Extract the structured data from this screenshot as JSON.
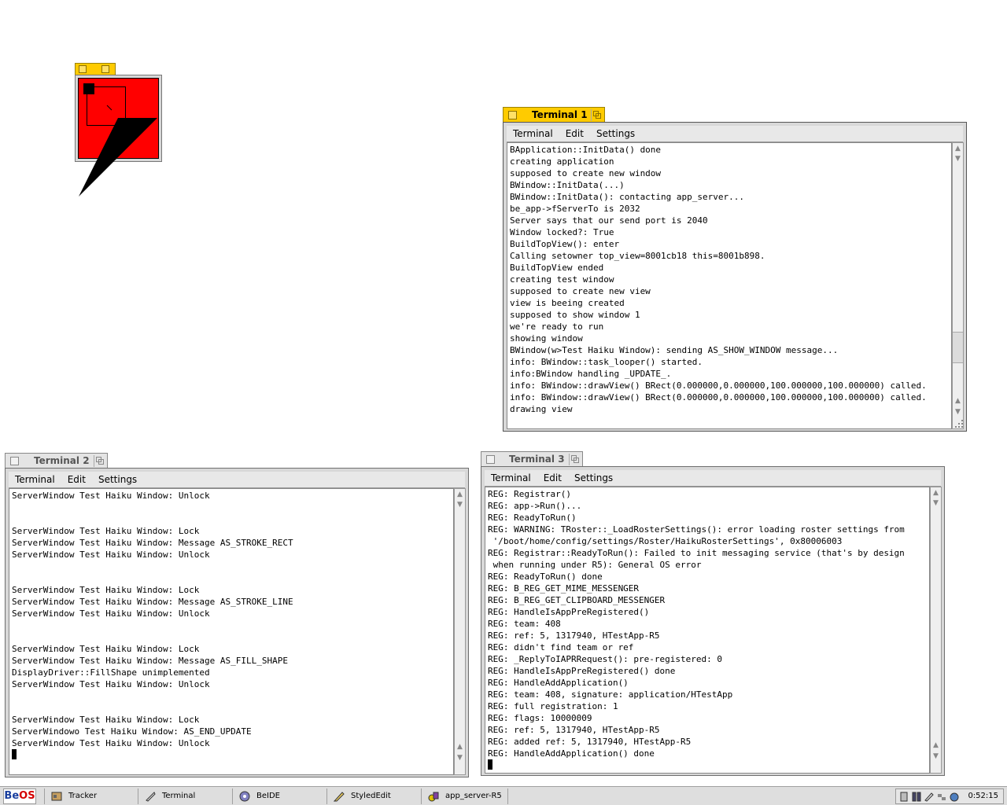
{
  "terminal1": {
    "title": "Terminal 1",
    "menu": [
      "Terminal",
      "Edit",
      "Settings"
    ],
    "lines": [
      "BApplication::InitData() done",
      "creating application",
      "supposed to create new window",
      "BWindow::InitData(...)",
      "BWindow::InitData(): contacting app_server...",
      "be_app->fServerTo is 2032",
      "Server says that our send port is 2040",
      "Window locked?: True",
      "BuildTopView(): enter",
      "Calling setowner top_view=8001cb18 this=8001b898.",
      "BuildTopView ended",
      "creating test window",
      "supposed to create new view",
      "view is beeing created",
      "supposed to show window 1",
      "we're ready to run",
      "showing window",
      "BWindow(w>Test Haiku Window): sending AS_SHOW_WINDOW message...",
      "info: BWindow::task_looper() started.",
      "info:BWindow handling _UPDATE_.",
      "info: BWindow::drawView() BRect(0.000000,0.000000,100.000000,100.000000) called.",
      "info: BWindow::drawView() BRect(0.000000,0.000000,100.000000,100.000000) called.",
      "drawing view"
    ]
  },
  "terminal2": {
    "title": "Terminal 2",
    "menu": [
      "Terminal",
      "Edit",
      "Settings"
    ],
    "lines": [
      "ServerWindow Test Haiku Window: Unlock",
      "",
      "",
      "ServerWindow Test Haiku Window: Lock",
      "ServerWindow Test Haiku Window: Message AS_STROKE_RECT",
      "ServerWindow Test Haiku Window: Unlock",
      "",
      "",
      "ServerWindow Test Haiku Window: Lock",
      "ServerWindow Test Haiku Window: Message AS_STROKE_LINE",
      "ServerWindow Test Haiku Window: Unlock",
      "",
      "",
      "ServerWindow Test Haiku Window: Lock",
      "ServerWindow Test Haiku Window: Message AS_FILL_SHAPE",
      "DisplayDriver::FillShape unimplemented",
      "ServerWindow Test Haiku Window: Unlock",
      "",
      "",
      "ServerWindow Test Haiku Window: Lock",
      "ServerWindowo Test Haiku Window: AS_END_UPDATE",
      "ServerWindow Test Haiku Window: Unlock"
    ]
  },
  "terminal3": {
    "title": "Terminal 3",
    "menu": [
      "Terminal",
      "Edit",
      "Settings"
    ],
    "lines": [
      "REG: Registrar()",
      "REG: app->Run()...",
      "REG: ReadyToRun()",
      "REG: WARNING: TRoster::_LoadRosterSettings(): error loading roster settings from",
      " '/boot/home/config/settings/Roster/HaikuRosterSettings', 0x80006003",
      "REG: Registrar::ReadyToRun(): Failed to init messaging service (that's by design",
      " when running under R5): General OS error",
      "REG: ReadyToRun() done",
      "REG: B_REG_GET_MIME_MESSENGER",
      "REG: B_REG_GET_CLIPBOARD_MESSENGER",
      "REG: HandleIsAppPreRegistered()",
      "REG: team: 408",
      "REG: ref: 5, 1317940, HTestApp-R5",
      "REG: didn't find team or ref",
      "REG: _ReplyToIAPRRequest(): pre-registered: 0",
      "REG: HandleIsAppPreRegistered() done",
      "REG: HandleAddApplication()",
      "REG: team: 408, signature: application/HTestApp",
      "REG: full registration: 1",
      "REG: flags: 10000009",
      "REG: ref: 5, 1317940, HTestApp-R5",
      "REG: added ref: 5, 1317940, HTestApp-R5",
      "REG: HandleAddApplication() done"
    ]
  },
  "deskbar": {
    "be_b": "Be",
    "be_o": "OS",
    "tasks": [
      "Tracker",
      "Terminal",
      "BeIDE",
      "StyledEdit",
      "app_server-R5"
    ],
    "clock": "0:52:15"
  },
  "colors": {
    "active_tab": "#ffcb00",
    "test_window": "#ff0000"
  }
}
